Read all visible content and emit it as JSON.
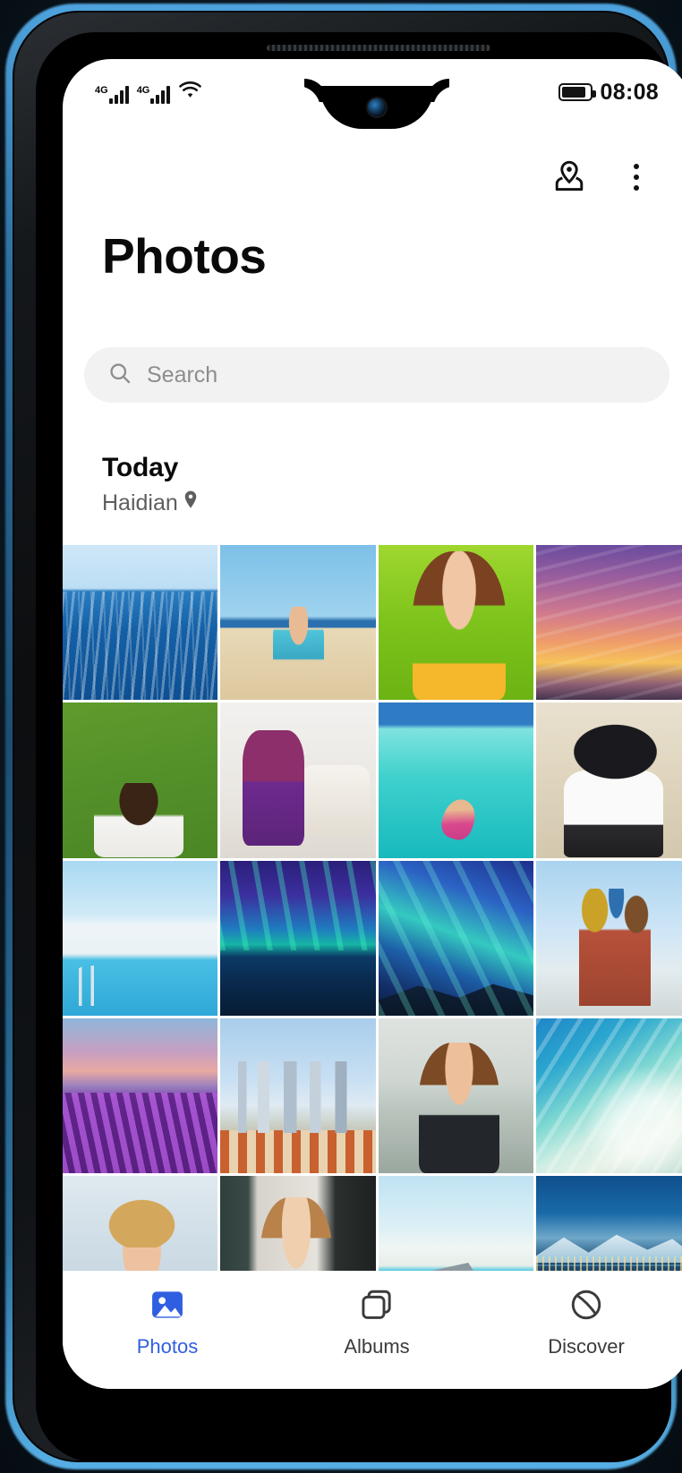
{
  "status_bar": {
    "signal_label_1": "4G",
    "signal_label_2": "4G",
    "wifi_icon": "wifi-icon",
    "battery_icon": "battery-icon",
    "time": "08:08"
  },
  "top_actions": {
    "location_icon": "map-location-icon",
    "overflow_icon": "more-vertical-icon"
  },
  "header": {
    "title": "Photos"
  },
  "search": {
    "icon": "search-icon",
    "placeholder": "Search",
    "value": ""
  },
  "section": {
    "title": "Today",
    "location": "Haidian",
    "location_icon": "location-pin-icon"
  },
  "grid": {
    "columns": 4,
    "photos": [
      {
        "alt": "Ocean waves under clear sky",
        "style": "ph-ocean"
      },
      {
        "alt": "Toddler laughing on sandy beach",
        "style": "ph-beachkid"
      },
      {
        "alt": "Portrait of woman in yellow top on green grass",
        "style": "ph-grasswoman"
      },
      {
        "alt": "Pink and orange sunset sky",
        "style": "ph-sunset"
      },
      {
        "alt": "Child lying on green lawn with arms spread",
        "style": "ph-grasskid"
      },
      {
        "alt": "Girl playing indoors with cardboard wings",
        "style": "ph-roomkid"
      },
      {
        "alt": "Swimmer in turquoise tropical lagoon",
        "style": "ph-lagoon"
      },
      {
        "alt": "Woman in black hat and sunglasses",
        "style": "ph-hatwoman"
      },
      {
        "alt": "Infinity pool with ladder and blue sky",
        "style": "ph-pool"
      },
      {
        "alt": "Aurora borealis reflected over lake",
        "style": "ph-aurora1"
      },
      {
        "alt": "Aurora borealis over snowy mountains",
        "style": "ph-aurora2"
      },
      {
        "alt": "Saint Basil's Cathedral in Moscow",
        "style": "ph-stbasil"
      },
      {
        "alt": "Lavender field at dusk with trees",
        "style": "ph-lavender"
      },
      {
        "alt": "Coastal city skyline with skyscrapers",
        "style": "ph-city"
      },
      {
        "alt": "Woman taking selfie by the waterfront",
        "style": "ph-selfie"
      },
      {
        "alt": "Aerial view of turquoise sandbank beach",
        "style": "ph-aerial"
      },
      {
        "alt": "Woman in straw hat smiling",
        "style": "ph-strawhat"
      },
      {
        "alt": "Woman resting head by a window",
        "style": "ph-window"
      },
      {
        "alt": "Poolside deck with loungers",
        "style": "ph-deck"
      },
      {
        "alt": "City skyline at night with mountains",
        "style": "ph-nightcity"
      }
    ]
  },
  "bottom_nav": {
    "active_color": "#2f5fe0",
    "items": [
      {
        "label": "Photos",
        "icon": "photo-icon",
        "active": true
      },
      {
        "label": "Albums",
        "icon": "albums-icon",
        "active": false
      },
      {
        "label": "Discover",
        "icon": "discover-icon",
        "active": false
      }
    ]
  }
}
